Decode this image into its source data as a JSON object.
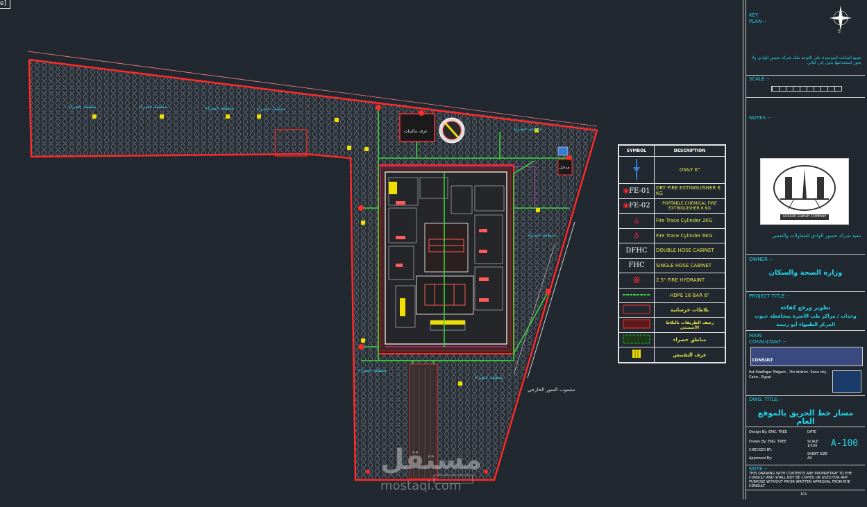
{
  "viewport": {
    "top_left_label": "e]"
  },
  "legend": {
    "header_symbol": "SYMBOL",
    "header_description": "DESCRIPTION",
    "rows": [
      {
        "symbol": "",
        "icon": "osy-valve-icon",
        "description": "OS&Y 6\""
      },
      {
        "symbol": "FE-01",
        "icon": "extinguisher-icon",
        "description": "DRY FIRE EXTINGUISHER 6 KG"
      },
      {
        "symbol": "FE-02",
        "icon": "extinguisher-icon",
        "description": "PORTABLE CHEMICAL FIRE EXTINGUISHER 6 KG"
      },
      {
        "symbol": "",
        "icon": "cylinder-icon",
        "description": "Fire Trace Cylinder 2KG"
      },
      {
        "symbol": "",
        "icon": "cylinder-icon",
        "description": "Fire Trace Cylinder 6KG"
      },
      {
        "symbol": "DFHC",
        "icon": "",
        "description": "DOUBLE HOSE CABINET"
      },
      {
        "symbol": "FHC",
        "icon": "",
        "description": "SINGLE HOSE CABINET"
      },
      {
        "symbol": "",
        "icon": "hydrant-icon",
        "description": "2.5\" FIRE HYDRAINT"
      },
      {
        "symbol": "",
        "icon": "pipe-icon",
        "description": "HDPE 16 BAR 6\""
      },
      {
        "symbol": "",
        "icon": "paving-icon",
        "description": "بلاطات خرسانية"
      },
      {
        "symbol": "",
        "icon": "red-box-icon",
        "description": "رصف الطريقات بالبلاط الأسمنتي"
      },
      {
        "symbol": "",
        "icon": "green-hatch-icon",
        "description": "مناطق خضراء"
      },
      {
        "symbol": "",
        "icon": "yellow-block-icon",
        "description": "غرف التفتيش"
      }
    ]
  },
  "title_block": {
    "key_plan": "KEY\nPLAN :-",
    "north_label": "N",
    "south_label": "S",
    "note_ar": "جميع البيانات الموجودة على اللوحة ملك شركة جسور الوادي ولا يجوز استخدامها بدون إذن كتابي",
    "scale": "SCALE :-",
    "notes": "NOTES :-",
    "company_logo_text": "GOSSOR ELWADY COMPANY",
    "company_ar": "تنفيذ شركة جسور الوادي للمقاولات والتعمير",
    "owner_label": "OWNER :-",
    "owner_ar": "وزارة الصحة والسكان",
    "project_label": "PROJECT TITLE :-",
    "project_ar_1": "تطوير ورفع كفاءة",
    "project_ar_2": "وحدات / مراكز طب الأسرة بمحافظة جنوب سيناء",
    "project_ar_3": "المركز الطبي - أبو زنيمة",
    "consultant_label": "MAIN\nCONSULTANT :-",
    "consultant_name": "CONSULT",
    "consultant_address": "6st Stadfrgar Pldgem . 7th district. 3ooo city , Cairo , Egypt",
    "dwg_label": "DWG. TITLE :-",
    "dwg_title_ar": "مسار خط الحريق بالموقع العام",
    "design_by": "Design By: ENG. TREE",
    "drawn_by": "Drawn By: ENG. TREE",
    "checked_by": "CHECKED BY:",
    "approved_by": "Approved By:",
    "date_label": "DATE",
    "scale_label": "SCALE\n1/100",
    "sheet_label": "SHEET SIZE\nA0",
    "dwg_number": "A-100",
    "note_label": "NOTE :-",
    "copyright": "THIS DRAWING WITH CONTENTS ARE PROPRIETARY TO EHE CONSULT AND SHALL NOT BE COPIED OR USED FOR ANY PURPOSE WITHOUT PRIOR WRITTEN APPROVAL FROM EHE CONSULT",
    "page_number": "101"
  },
  "site_labels": {
    "label_1": "غرف ماكينات",
    "label_2": "منسوب السور الخارجي",
    "label_3": "منطقة خضراء",
    "label_4": "مدخل"
  },
  "watermark": {
    "ar": "مستقل",
    "en": "mostaqi.com"
  },
  "colors": {
    "background": "#212830",
    "boundary": "#ff2a2a",
    "fire_line": "#3ad43a",
    "text_cyan": "#22d3e6",
    "legend_text": "#e8e84a"
  }
}
